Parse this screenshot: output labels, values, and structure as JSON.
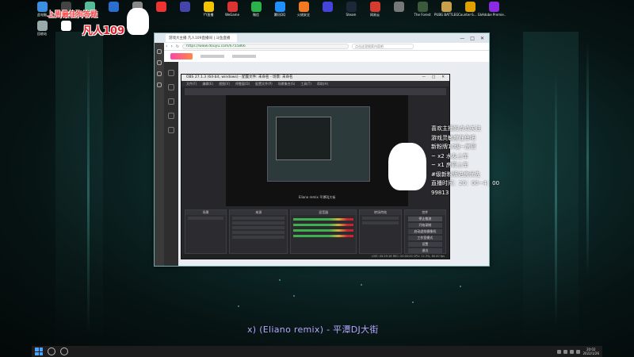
{
  "desktop": {
    "top_icons": [
      {
        "label": "此电脑",
        "color": "#3b8fe0"
      },
      {
        "label": "",
        "color": "#444"
      },
      {
        "label": "",
        "color": "#5b9"
      },
      {
        "label": "",
        "color": "#2a6fd0"
      },
      {
        "label": "",
        "color": "#888"
      },
      {
        "label": "",
        "color": "#e33"
      },
      {
        "label": "",
        "color": "#44a"
      },
      {
        "label": "YY直播",
        "color": "#f5c400"
      },
      {
        "label": "WeGame",
        "color": "#d33"
      },
      {
        "label": "微信",
        "color": "#2ab34a"
      },
      {
        "label": "腾讯QQ",
        "color": "#1e90ff"
      },
      {
        "label": "火绒安全",
        "color": "#f37a20"
      },
      {
        "label": "",
        "color": "#44d"
      },
      {
        "label": "Steam",
        "color": "#1b2838"
      },
      {
        "label": "网易云",
        "color": "#d63b2f"
      },
      {
        "label": "",
        "color": "#777"
      },
      {
        "label": "The Forest",
        "color": "#3a5a3a"
      },
      {
        "label": "PUBG BATTLEGR...",
        "color": "#c8a04a"
      },
      {
        "label": "Counter-S... Global Off...",
        "color": "#e0a000"
      },
      {
        "label": "Adobe Premie...",
        "color": "#8a2be2"
      }
    ],
    "second_row": [
      {
        "label": "回收站",
        "color": "#9aa"
      },
      {
        "label": "",
        "color": "#fff"
      }
    ]
  },
  "overlay": {
    "title_text": "上周最佳狗答题",
    "fan_text": "凡人109",
    "notes": [
      "喜欢主播的点点关注",
      "游戏灵敏度在鱼吧",
      "新粉牌10级~房管",
      "~ x2 水友上车",
      "~ x1 房管上车",
      "#级新粉牌进房优先",
      "直播时间：20：00~4：00",
      "99813"
    ],
    "lyric": "x)  (Eliano remix)  - 平潭DJ大街"
  },
  "browser": {
    "tab_title": "游戏大主播 凡人109直播间 | 斗鱼直播",
    "url": "https://www.douyu.com/6755866",
    "search_placeholder": "点击这里搜索内容吧",
    "controls": [
      "—",
      "□",
      "✕"
    ]
  },
  "obs": {
    "title": "OBS 27.1.3 (64-bit, windows) - 配置文件: 未命名 - 场景: 未命名",
    "menu": [
      "文件(F)",
      "编辑(E)",
      "视图(V)",
      "停靠窗(D)",
      "配置文件(P)",
      "场景集合(S)",
      "工具(T)",
      "帮助(H)"
    ],
    "preview_caption": "Eliano remix     平潭DJ大街",
    "docks": [
      "场景",
      "来源",
      "混音器",
      "转场特效",
      "控件"
    ],
    "controls": [
      "停止推流",
      "开始录制",
      "启动虚拟摄像机",
      "工作室模式",
      "设置",
      "退出"
    ],
    "status": "LIVE: 00:29:16   REC: 00:00:00   CPU: 12.3%, 60.00 fps"
  },
  "taskbar": {
    "time": "20:02",
    "date": "2022/1/26"
  }
}
